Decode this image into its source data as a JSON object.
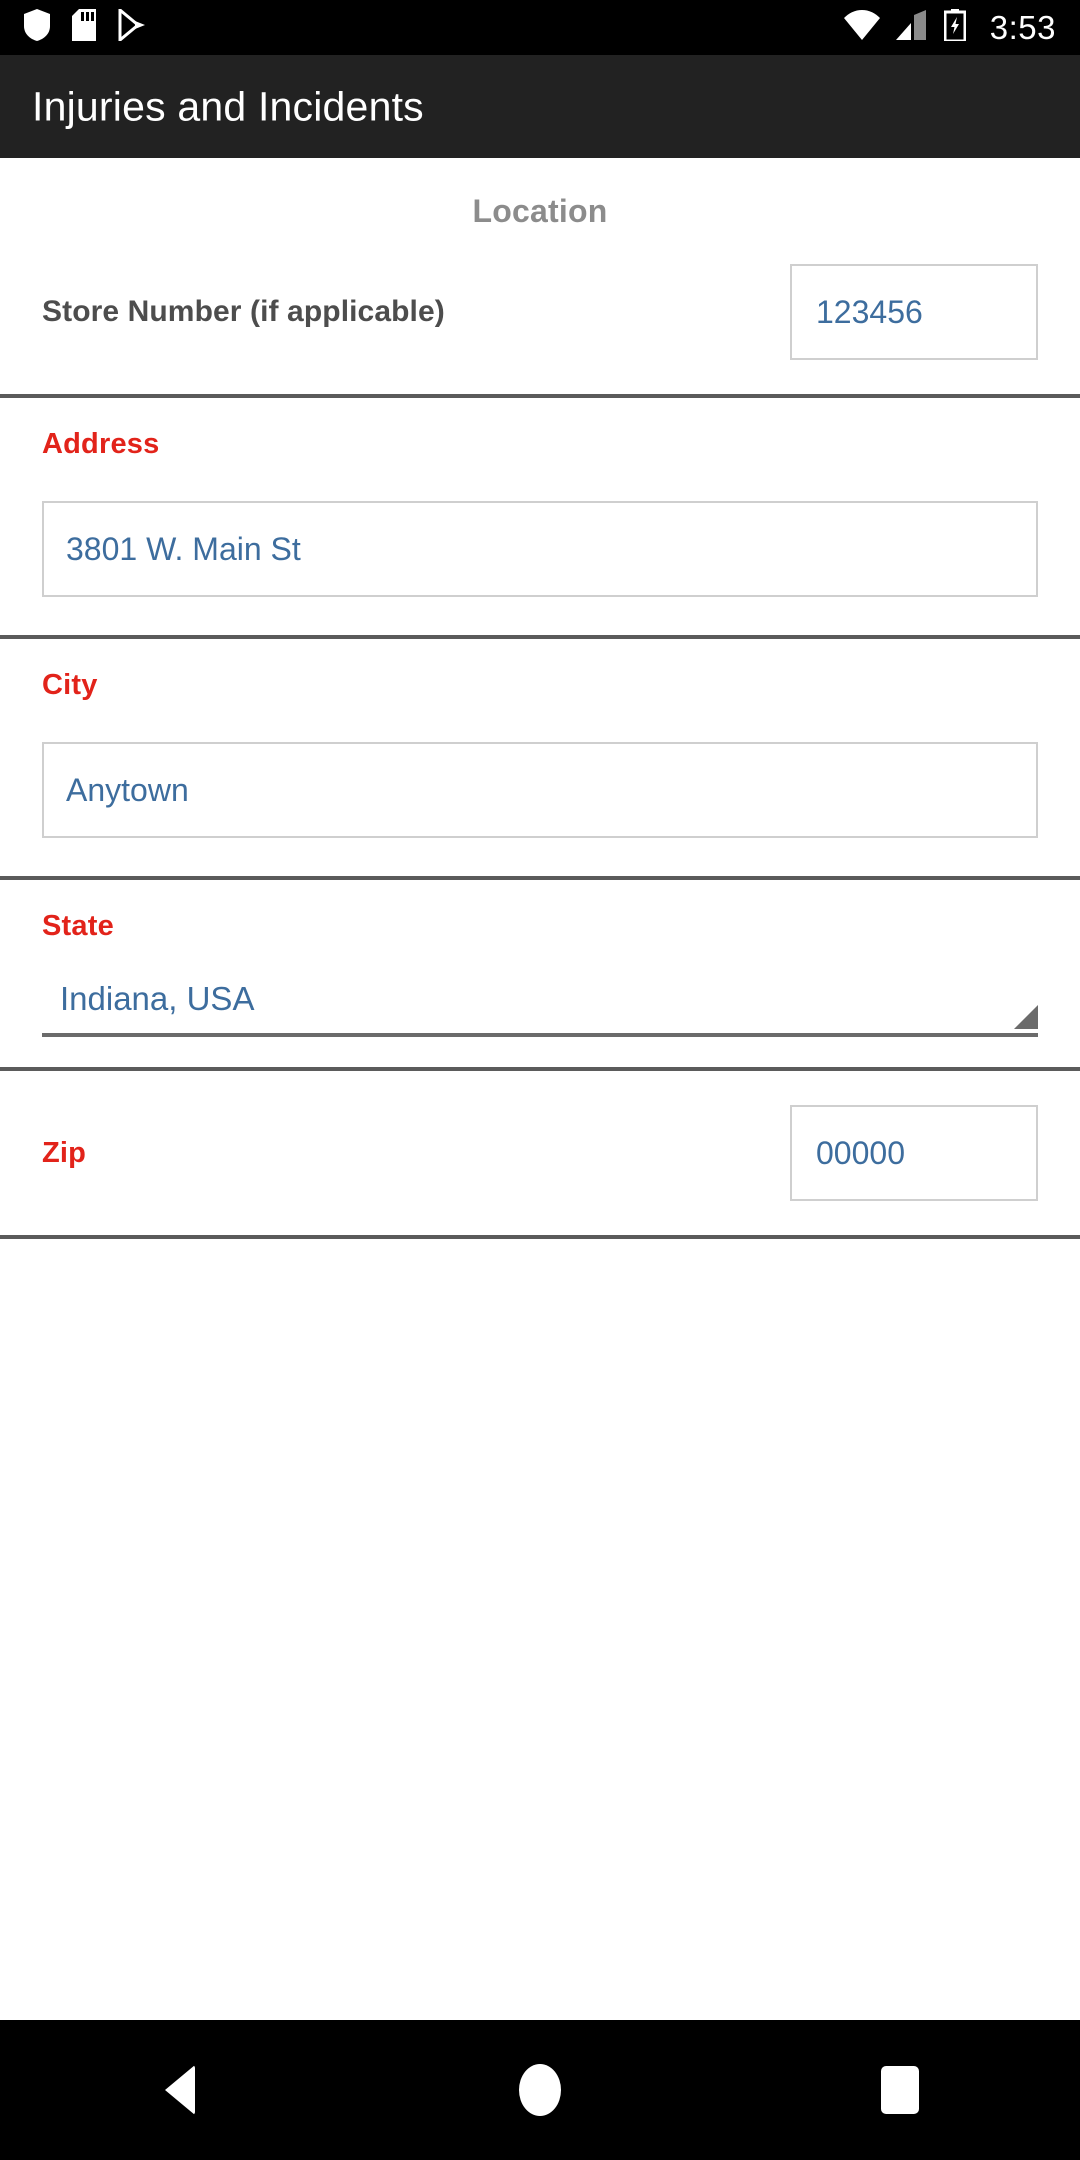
{
  "status_bar": {
    "time": "3:53",
    "left_icons": [
      "shield-icon",
      "sd-card-icon",
      "play-store-icon"
    ],
    "right_icons": [
      "wifi-icon",
      "cellular-signal-icon",
      "battery-charging-icon"
    ]
  },
  "app_bar": {
    "title": "Injuries and Incidents",
    "background": "#222222"
  },
  "form": {
    "section_title": "Location",
    "fields": {
      "store_number": {
        "label": "Store Number (if applicable)",
        "value": "123456",
        "label_color": "#4d4d4d"
      },
      "address": {
        "label": "Address",
        "value": "3801 W. Main St",
        "label_color": "#e2231a"
      },
      "city": {
        "label": "City",
        "value": "Anytown",
        "label_color": "#e2231a"
      },
      "state": {
        "label": "State",
        "value": "Indiana, USA",
        "label_color": "#e2231a"
      },
      "zip": {
        "label": "Zip",
        "value": "00000",
        "label_color": "#e2231a"
      }
    }
  },
  "nav_bar": {
    "back": "back-button",
    "home": "home-button",
    "recents": "recents-button"
  },
  "colors": {
    "required_red": "#e2231a",
    "input_text_blue": "#3d6d9e",
    "divider_gray": "#5b5b5b",
    "section_title_gray": "#8c8c8c"
  }
}
